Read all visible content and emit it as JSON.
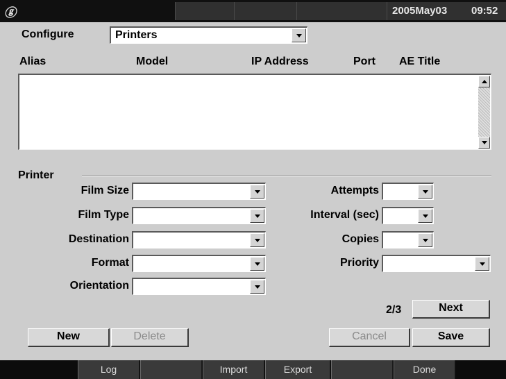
{
  "status_bar": {
    "logo": "ⓖ",
    "date": "2005May03",
    "time": "09:52"
  },
  "configure": {
    "label": "Configure",
    "selected": "Printers"
  },
  "table": {
    "columns": [
      "Alias",
      "Model",
      "IP Address",
      "Port",
      "AE Title"
    ],
    "rows": []
  },
  "printer": {
    "section_label": "Printer",
    "film_size": {
      "label": "Film Size",
      "value": ""
    },
    "film_type": {
      "label": "Film Type",
      "value": ""
    },
    "destination": {
      "label": "Destination",
      "value": ""
    },
    "format": {
      "label": "Format",
      "value": ""
    },
    "orientation": {
      "label": "Orientation",
      "value": ""
    },
    "attempts": {
      "label": "Attempts",
      "value": ""
    },
    "interval": {
      "label": "Interval (sec)",
      "value": ""
    },
    "copies": {
      "label": "Copies",
      "value": ""
    },
    "priority": {
      "label": "Priority",
      "value": ""
    }
  },
  "paging": {
    "indicator": "2/3",
    "next_label": "Next"
  },
  "actions": {
    "new": "New",
    "delete": "Delete",
    "cancel": "Cancel",
    "save": "Save"
  },
  "bottom_bar": [
    "Log",
    "",
    "Import",
    "Export",
    "",
    "Done"
  ]
}
